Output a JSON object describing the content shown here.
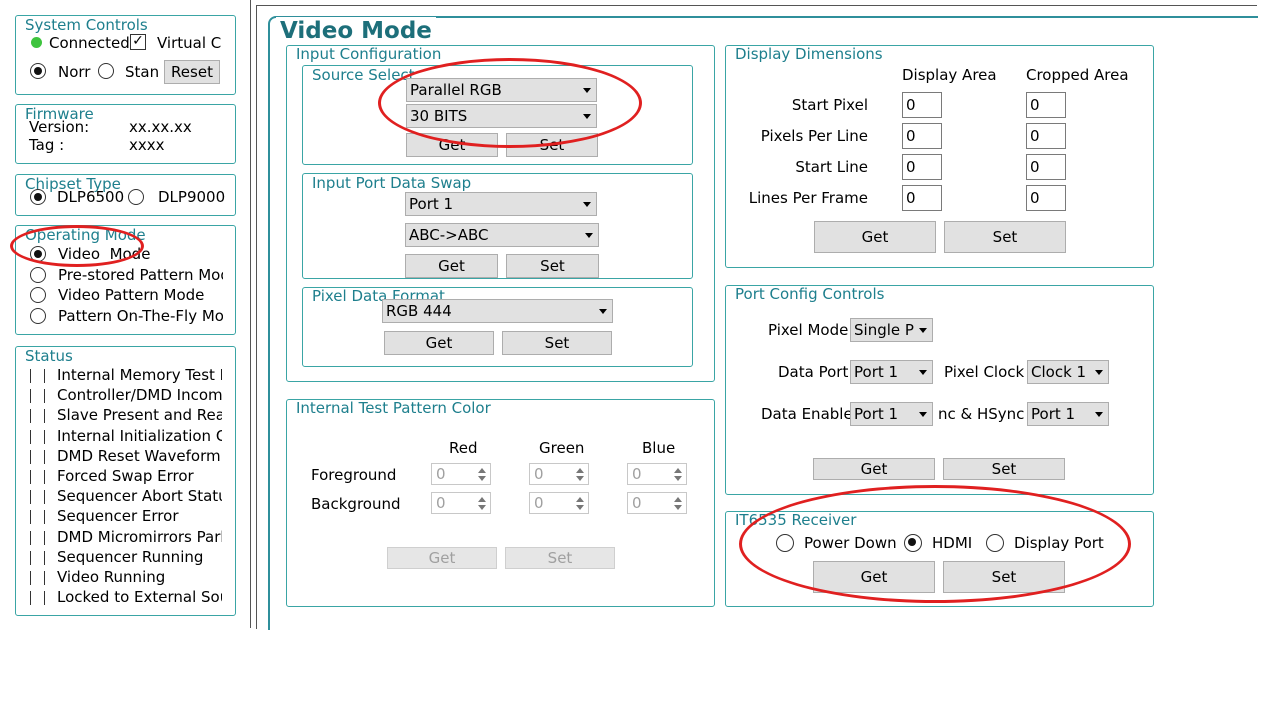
{
  "system_controls": {
    "title": "System Controls",
    "connected": "Connected",
    "virtual": "Virtual Co",
    "normal": "Norr",
    "standby": "Stan",
    "reset": "Reset"
  },
  "firmware": {
    "title": "Firmware",
    "version_label": "Version:",
    "version_value": "xx.xx.xx",
    "tag_label": "Tag :",
    "tag_value": "xxxx"
  },
  "chipset": {
    "title": "Chipset Type",
    "opt1": "DLP6500",
    "opt2": "DLP9000"
  },
  "operating_mode": {
    "title": "Operating Mode",
    "items": [
      "Video  Mode",
      "Pre-stored Pattern Mod",
      "Video Pattern Mode",
      "Pattern On-The-Fly Moc"
    ]
  },
  "status": {
    "title": "Status",
    "items": [
      "Internal Memory Test P",
      "Controller/DMD Incomi",
      "Slave Present and Read",
      "Internal Initialization Cc",
      "DMD Reset Waveform C",
      "Forced Swap Error",
      "Sequencer Abort Status",
      "Sequencer Error",
      "DMD Micromirrors Park",
      "Sequencer Running",
      "Video Running",
      "Locked to External Sour"
    ]
  },
  "main": {
    "title": "Video Mode"
  },
  "input_config": {
    "title": "Input Configuration",
    "source_select": {
      "title": "Source Select",
      "source": "Parallel RGB",
      "bits": "30 BITS",
      "get": "Get",
      "set": "Set"
    },
    "port_swap": {
      "title": "Input Port Data Swap",
      "port": "Port 1",
      "swap": "ABC->ABC",
      "get": "Get",
      "set": "Set"
    },
    "pixel_format": {
      "title": "Pixel Data Format",
      "format": "RGB 444",
      "get": "Get",
      "set": "Set"
    }
  },
  "test_pattern": {
    "title": "Internal Test Pattern Color",
    "red": "Red",
    "green": "Green",
    "blue": "Blue",
    "foreground": "Foreground",
    "background": "Background",
    "fg_values": [
      "0",
      "0",
      "0"
    ],
    "bg_values": [
      "0",
      "0",
      "0"
    ],
    "get": "Get",
    "set": "Set"
  },
  "display_dims": {
    "title": "Display Dimensions",
    "col1": "Display Area",
    "col2": "Cropped Area",
    "rows": [
      {
        "label": "Start Pixel",
        "a": "0",
        "b": "0"
      },
      {
        "label": "Pixels Per Line",
        "a": "0",
        "b": "0"
      },
      {
        "label": "Start Line",
        "a": "0",
        "b": "0"
      },
      {
        "label": "Lines Per Frame",
        "a": "0",
        "b": "0"
      }
    ],
    "get": "Get",
    "set": "Set"
  },
  "port_config": {
    "title": "Port Config Controls",
    "pixel_mode_label": "Pixel Mode",
    "pixel_mode": "Single P",
    "data_port_label": "Data Port",
    "data_port": "Port 1",
    "pixel_clock_label": "Pixel Clock",
    "pixel_clock": "Clock 1",
    "data_enable_label": "Data Enable",
    "data_enable": "Port 1",
    "sync_label": "nc & HSync",
    "sync": "Port 1",
    "get": "Get",
    "set": "Set"
  },
  "receiver": {
    "title": "IT6535 Receiver",
    "power_down": "Power Down",
    "hdmi": "HDMI",
    "display_port": "Display Port",
    "get": "Get",
    "set": "Set"
  },
  "annotation_color": "#e02020"
}
